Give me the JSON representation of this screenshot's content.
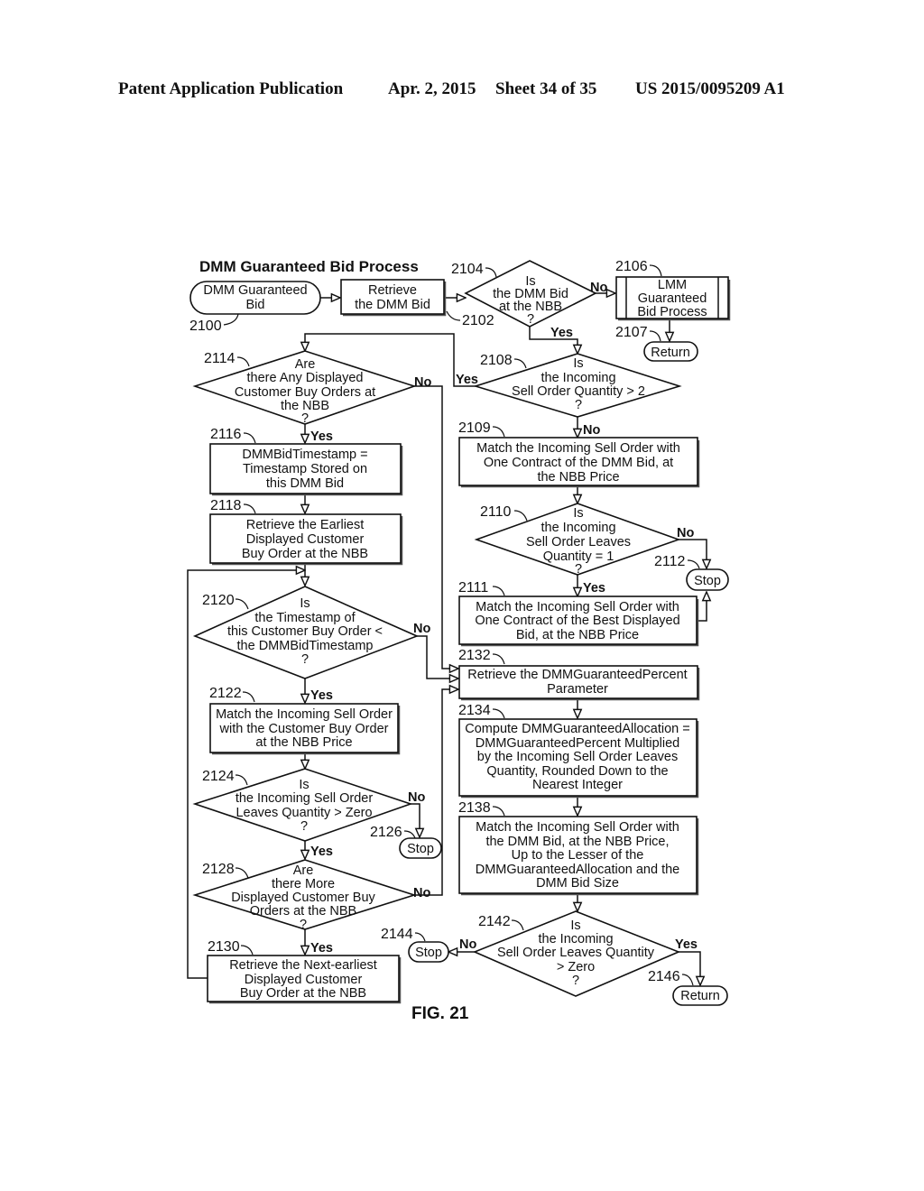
{
  "header": {
    "publication": "Patent Application Publication",
    "date": "Apr. 2, 2015",
    "sheet": "Sheet 34 of 35",
    "number": "US 2015/0095209 A1"
  },
  "diagram": {
    "title": "DMM Guaranteed Bid Process",
    "figure_label": "FIG. 21",
    "nodes": {
      "n2100": {
        "ref": "2100",
        "type": "terminator",
        "lines": [
          "DMM Guaranteed",
          "Bid"
        ]
      },
      "n2102": {
        "ref": "2102",
        "type": "process",
        "lines": [
          "Retrieve",
          "the DMM Bid"
        ]
      },
      "n2104": {
        "ref": "2104",
        "type": "decision",
        "lines": [
          "Is",
          "the DMM Bid",
          "at the NBB",
          "?"
        ]
      },
      "n2106": {
        "ref": "2106",
        "type": "predefined-process",
        "lines": [
          "LMM",
          "Guaranteed",
          "Bid Process"
        ]
      },
      "n2107": {
        "ref": "2107",
        "type": "terminator",
        "lines": [
          "Return"
        ]
      },
      "n2108": {
        "ref": "2108",
        "type": "decision",
        "lines": [
          "Is",
          "the Incoming",
          "Sell Order Quantity > 2",
          "?"
        ]
      },
      "n2109": {
        "ref": "2109",
        "type": "process",
        "lines": [
          "Match the Incoming Sell Order with",
          "One Contract of the DMM Bid, at",
          "the NBB Price"
        ]
      },
      "n2110": {
        "ref": "2110",
        "type": "decision",
        "lines": [
          "Is",
          "the Incoming",
          "Sell Order Leaves",
          "Quantity = 1",
          "?"
        ]
      },
      "n2111": {
        "ref": "2111",
        "type": "process",
        "lines": [
          "Match the Incoming Sell Order with",
          "One Contract of the Best Displayed",
          "Bid, at the NBB Price"
        ]
      },
      "n2112": {
        "ref": "2112",
        "type": "terminator",
        "lines": [
          "Stop"
        ]
      },
      "n2114": {
        "ref": "2114",
        "type": "decision",
        "lines": [
          "Are",
          "there Any Displayed",
          "Customer Buy Orders at",
          "the NBB",
          "?"
        ]
      },
      "n2116": {
        "ref": "2116",
        "type": "process",
        "lines": [
          "DMMBidTimestamp =",
          "Timestamp Stored on",
          "this DMM Bid"
        ]
      },
      "n2118": {
        "ref": "2118",
        "type": "process",
        "lines": [
          "Retrieve the Earliest",
          "Displayed Customer",
          "Buy Order at the NBB"
        ]
      },
      "n2120": {
        "ref": "2120",
        "type": "decision",
        "lines": [
          "Is",
          "the Timestamp of",
          "this Customer Buy Order <",
          "the DMMBidTimestamp",
          "?"
        ]
      },
      "n2122": {
        "ref": "2122",
        "type": "process",
        "lines": [
          "Match the Incoming Sell Order",
          "with the Customer Buy Order",
          "at the NBB Price"
        ]
      },
      "n2124": {
        "ref": "2124",
        "type": "decision",
        "lines": [
          "Is",
          "the Incoming Sell Order",
          "Leaves Quantity > Zero",
          "?"
        ]
      },
      "n2126": {
        "ref": "2126",
        "type": "terminator",
        "lines": [
          "Stop"
        ]
      },
      "n2128": {
        "ref": "2128",
        "type": "decision",
        "lines": [
          "Are",
          "there More",
          "Displayed Customer Buy",
          "Orders at the NBB",
          "?"
        ]
      },
      "n2130": {
        "ref": "2130",
        "type": "process",
        "lines": [
          "Retrieve the Next-earliest",
          "Displayed Customer",
          "Buy Order at the NBB"
        ]
      },
      "n2132": {
        "ref": "2132",
        "type": "process",
        "lines": [
          "Retrieve the DMMGuaranteedPercent",
          "Parameter"
        ]
      },
      "n2134": {
        "ref": "2134",
        "type": "process",
        "lines": [
          "Compute DMMGuaranteedAllocation =",
          "DMMGuaranteedPercent Multiplied",
          "by the Incoming Sell Order Leaves",
          "Quantity, Rounded Down to the",
          "Nearest Integer"
        ]
      },
      "n2138": {
        "ref": "2138",
        "type": "process",
        "lines": [
          "Match the Incoming Sell Order with",
          "the DMM Bid, at the NBB Price,",
          "Up to the Lesser of the",
          "DMMGuaranteedAllocation and the",
          "DMM Bid Size"
        ]
      },
      "n2142": {
        "ref": "2142",
        "type": "decision",
        "lines": [
          "Is",
          "the Incoming",
          "Sell Order Leaves Quantity",
          "> Zero",
          "?"
        ]
      },
      "n2144": {
        "ref": "2144",
        "type": "terminator",
        "lines": [
          "Stop"
        ]
      },
      "n2146": {
        "ref": "2146",
        "type": "terminator",
        "lines": [
          "Return"
        ]
      }
    },
    "edges": [
      {
        "from": "2100",
        "to": "2102",
        "label": ""
      },
      {
        "from": "2102",
        "to": "2104",
        "label": ""
      },
      {
        "from": "2104",
        "to": "2106",
        "label": "No"
      },
      {
        "from": "2104",
        "to": "2108",
        "label": "Yes"
      },
      {
        "from": "2106",
        "to": "2107",
        "label": ""
      },
      {
        "from": "2108",
        "to": "2114",
        "label": "Yes"
      },
      {
        "from": "2108",
        "to": "2109",
        "label": "No"
      },
      {
        "from": "2109",
        "to": "2110",
        "label": ""
      },
      {
        "from": "2110",
        "to": "2112",
        "label": "No"
      },
      {
        "from": "2110",
        "to": "2111",
        "label": "Yes"
      },
      {
        "from": "2111",
        "to": "2112",
        "label": ""
      },
      {
        "from": "2114",
        "to": "2116",
        "label": "Yes"
      },
      {
        "from": "2114",
        "to": "2132",
        "label": "No"
      },
      {
        "from": "2116",
        "to": "2118",
        "label": ""
      },
      {
        "from": "2118",
        "to": "2120",
        "label": ""
      },
      {
        "from": "2120",
        "to": "2122",
        "label": "Yes"
      },
      {
        "from": "2120",
        "to": "2132",
        "label": "No"
      },
      {
        "from": "2122",
        "to": "2124",
        "label": ""
      },
      {
        "from": "2124",
        "to": "2126",
        "label": "No"
      },
      {
        "from": "2124",
        "to": "2128",
        "label": "Yes"
      },
      {
        "from": "2128",
        "to": "2130",
        "label": "Yes"
      },
      {
        "from": "2128",
        "to": "2132",
        "label": "No"
      },
      {
        "from": "2130",
        "to": "2120",
        "label": ""
      },
      {
        "from": "2132",
        "to": "2134",
        "label": ""
      },
      {
        "from": "2134",
        "to": "2138",
        "label": ""
      },
      {
        "from": "2138",
        "to": "2142",
        "label": ""
      },
      {
        "from": "2142",
        "to": "2144",
        "label": "No"
      },
      {
        "from": "2142",
        "to": "2146",
        "label": "Yes"
      }
    ],
    "labels": {
      "yes": "Yes",
      "no": "No"
    }
  }
}
